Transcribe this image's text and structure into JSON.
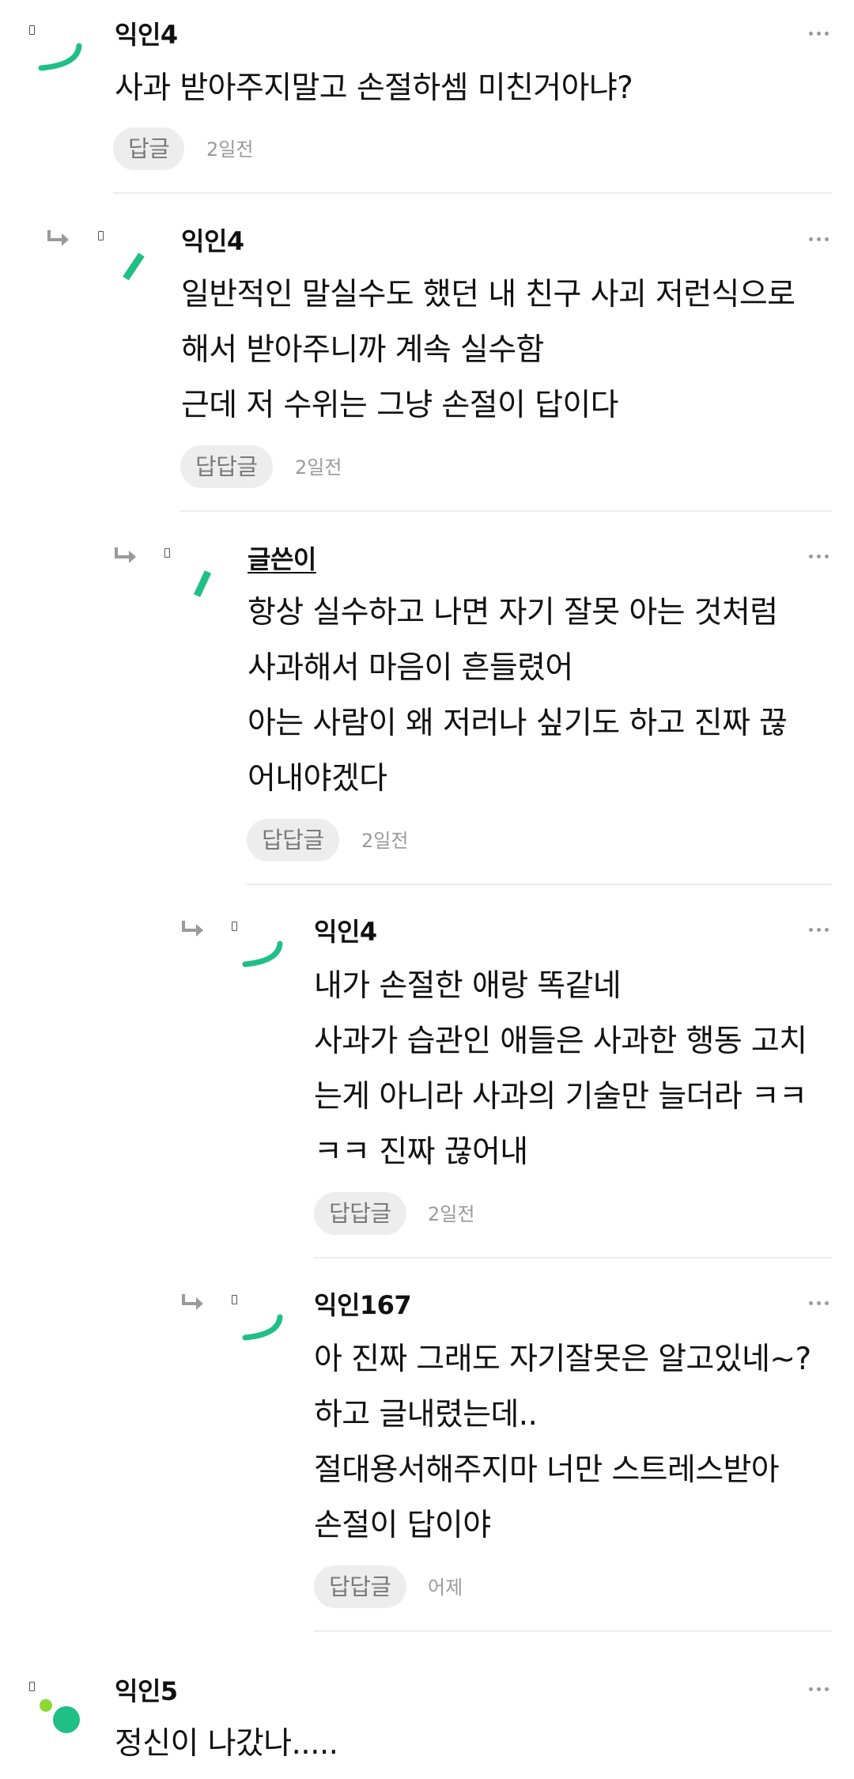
{
  "colors": {
    "accent": "#1fbf85",
    "lime": "#8ed834",
    "muted": "#9a9a9a",
    "button_bg": "#ededed"
  },
  "comments": [
    {
      "author": "익인4",
      "lines": [
        "사과 받아주지말고 손절하셈 미친거아냐?"
      ],
      "reply_label": "답글",
      "time": "2일전",
      "more_icon": "more-horizontal-icon",
      "avatar_icon": "green-arc-avatar-icon"
    },
    {
      "author": "익인4",
      "lines": [
        "일반적인 말실수도 했던 내 친구 사괴 저런식으로",
        "해서 받아주니까 계속 실수함",
        "근데 저 수위는 그냥 손절이 답이다"
      ],
      "reply_label": "답답글",
      "time": "2일전",
      "more_icon": "more-horizontal-icon",
      "reply_arrow_icon": "reply-arrow-icon",
      "avatar_icon": "green-stroke-avatar-icon"
    },
    {
      "author": "글쓴이",
      "lines": [
        "항상 실수하고 나면 자기 잘못 아는 것처럼",
        "사과해서 마음이 흔들렸어",
        "아는 사람이 왜 저러나 싶기도 하고 진짜 끊",
        "어내야겠다"
      ],
      "reply_label": "답답글",
      "time": "2일전",
      "more_icon": "more-horizontal-icon",
      "reply_arrow_icon": "reply-arrow-icon",
      "avatar_icon": "green-stroke-avatar-icon"
    },
    {
      "author": "익인4",
      "lines": [
        "내가 손절한 애랑 똑같네",
        "사과가 습관인 애들은 사과한 행동 고치",
        "는게 아니라 사과의 기술만 늘더라 ㅋㅋ",
        "ㅋㅋ 진짜 끊어내"
      ],
      "reply_label": "답답글",
      "time": "2일전",
      "more_icon": "more-horizontal-icon",
      "reply_arrow_icon": "reply-arrow-icon",
      "avatar_icon": "green-arc-avatar-icon"
    },
    {
      "author": "익인167",
      "lines": [
        "아 진짜 그래도 자기잘못은 알고있네~?",
        "하고 글내렸는데..",
        "절대용서해주지마 너만 스트레스받아",
        "손절이 답이야"
      ],
      "reply_label": "답답글",
      "time": "어제",
      "more_icon": "more-horizontal-icon",
      "reply_arrow_icon": "reply-arrow-icon",
      "avatar_icon": "green-arc-avatar-icon"
    },
    {
      "author": "익인5",
      "lines": [
        "정신이 나갔나....."
      ],
      "more_icon": "more-horizontal-icon",
      "avatar_icon": "green-dots-avatar-icon"
    }
  ]
}
